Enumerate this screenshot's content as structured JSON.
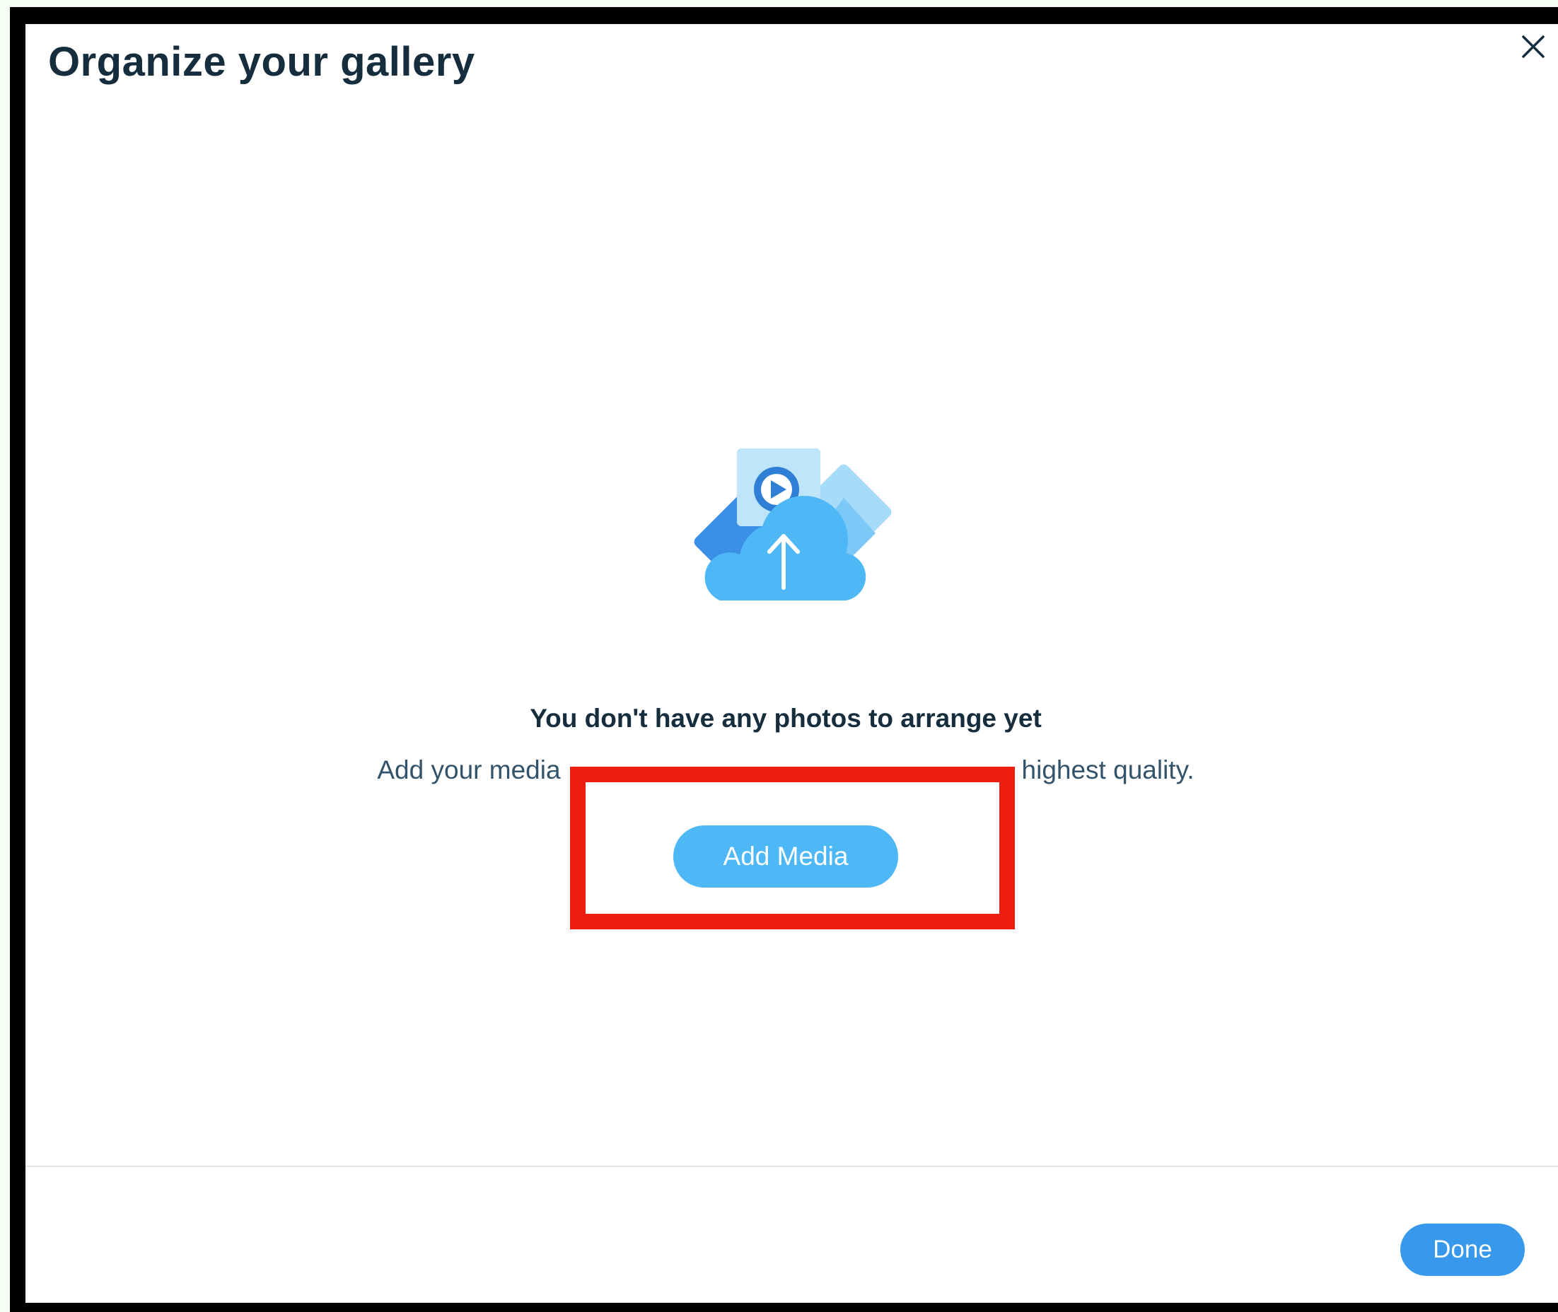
{
  "dialog": {
    "title": "Organize your gallery",
    "close_icon": "close-icon"
  },
  "empty_state": {
    "illustration_icon": "cloud-upload-media-icon",
    "heading": "You don't have any photos to arrange yet",
    "subtext_before": "Add your media",
    "subtext_after": "highest quality.",
    "add_media_label": "Add Media"
  },
  "annotation": {
    "highlight_color": "#ee1d12"
  },
  "footer": {
    "done_label": "Done"
  },
  "colors": {
    "title_text": "#162d3d",
    "body_text": "#32536a",
    "add_media_button": "#4eb7f5",
    "done_button": "#3899ec",
    "divider": "#dfe5eb"
  }
}
